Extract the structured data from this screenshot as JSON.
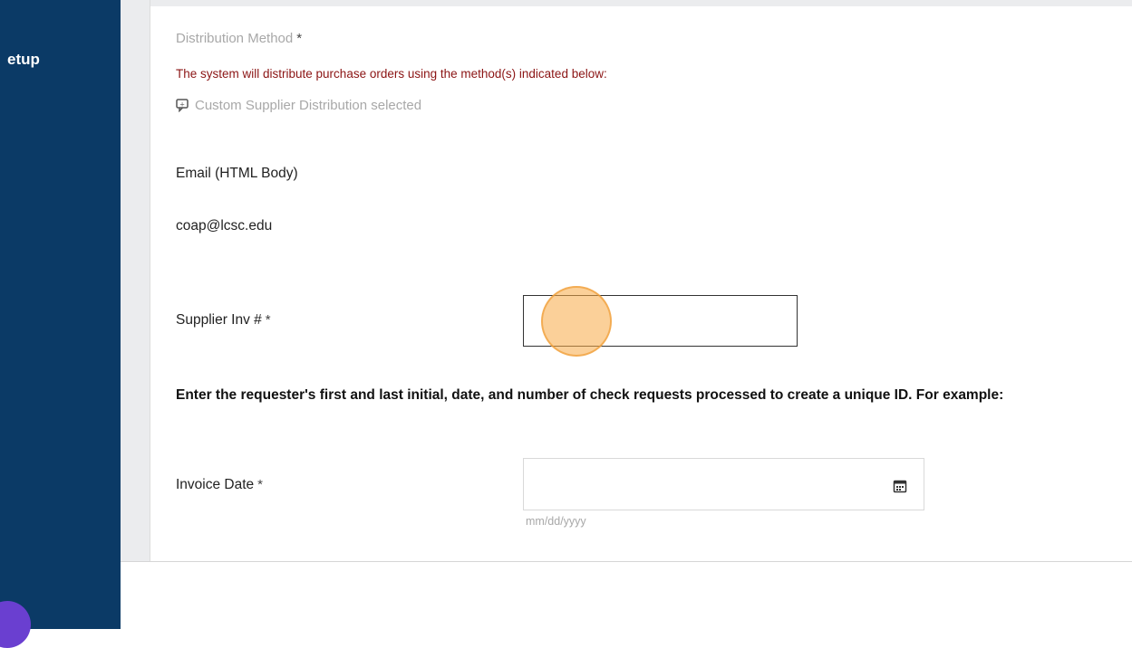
{
  "sidebar": {
    "label": "etup"
  },
  "form": {
    "distribution_method": {
      "label": "Distribution Method",
      "required_mark": "*",
      "notice": "The system will distribute purchase orders using the method(s) indicated below:",
      "custom_text": "Custom Supplier Distribution selected",
      "custom_icon": "comment-icon",
      "method": "Email (HTML Body)",
      "email": "coap@lcsc.edu"
    },
    "supplier_inv": {
      "label": "Supplier Inv #",
      "required_mark": "*",
      "value": ""
    },
    "instruction": "Enter the requester's first and last initial, date, and number of check requests processed to create a unique ID. For example:",
    "invoice_date": {
      "label": "Invoice Date",
      "required_mark": "*",
      "value": "",
      "format_hint": "mm/dd/yyyy",
      "icon": "calendar-icon"
    }
  },
  "colors": {
    "sidebar": "#0b3a66",
    "notice": "#8b1414",
    "click_highlight": "#f7aa46"
  }
}
